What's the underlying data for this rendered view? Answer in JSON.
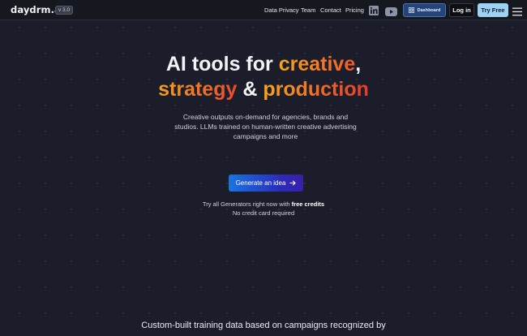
{
  "nav": {
    "logo": "daydrm.ai",
    "version": "v 3.0",
    "links": [
      "Data Privacy",
      "Team",
      "Contact",
      "Pricing"
    ],
    "social_icons": [
      "linkedin-icon",
      "youtube-icon"
    ],
    "dashboard_label": "Dashboard",
    "login_label": "Log in",
    "try_free_label": "Try Free",
    "menu_icon": "hamburger-icon"
  },
  "hero": {
    "title_line1_plain": "AI tools for ",
    "title_line1_highlight": "creative",
    "title_line1_end": ",",
    "title_line2_highlight1": "strategy",
    "title_line2_mid": " & ",
    "title_line2_highlight2": "production",
    "subtitle": "Creative outputs on-demand for agencies, brands and studios. LLMs trained on human-written creative advertising campaigns and more",
    "cta_label": "Generate an idea",
    "cta_icon": "arrow-right-icon",
    "note_prefix": "Try all Generators right now with ",
    "note_bold": "free credits",
    "note_line2": "No credit card required"
  },
  "bottom": {
    "text": "Custom-built training data based on campaigns recognized by"
  },
  "colors": {
    "background": "#1b1e2a",
    "accent_orange": "#f7a21d",
    "accent_red": "#e8392b",
    "try_free_bg": "#9ed2f5",
    "dashboard_bg": "#24457a"
  }
}
